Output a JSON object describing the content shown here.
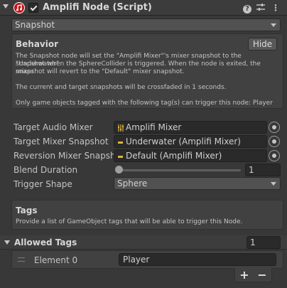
{
  "header": {
    "title": "Amplifi Node (Script)"
  },
  "node_type": {
    "selected": "Snapshot"
  },
  "behavior": {
    "title": "Behavior",
    "hide_label": "Hide",
    "desc_line1": "The Snapshot node will set the \"Amplifi Mixer\"'s mixer snapshot to the \"Underwater\"",
    "desc_line2": "snapshot when the SphereCollider is triggered. When the node is exited, the mixer",
    "desc_line3": "snapshot will revert to the \"Default\" mixer snapshot.",
    "crossfade": "The current and target snapshots will be crossfaded in 1 seconds.",
    "tags_note": "Only game objects tagged with the following tag(s) can trigger this node: Player"
  },
  "fields": {
    "target_audio_mixer": {
      "label": "Target Audio Mixer",
      "value": "Amplifi Mixer"
    },
    "target_mixer_snapshot": {
      "label": "Target Mixer Snapshot",
      "value": "Underwater (Amplifi Mixer)"
    },
    "reversion_mixer_snapshot": {
      "label": "Reversion Mixer Snapshot",
      "value": "Default (Amplifi Mixer)"
    },
    "blend_duration": {
      "label": "Blend Duration",
      "value": "1",
      "fraction": 0.0
    },
    "trigger_shape": {
      "label": "Trigger Shape",
      "value": "Sphere"
    }
  },
  "tags": {
    "title": "Tags",
    "desc": "Provide a list of GameObject tags that will be able to trigger this Node."
  },
  "allowed_tags": {
    "title": "Allowed Tags",
    "count": "1",
    "elements": [
      {
        "label": "Element 0",
        "value": "Player"
      }
    ],
    "add_label": "+",
    "remove_label": "−"
  },
  "colors": {
    "background": "#383838",
    "panel": "#414141",
    "field": "#2a2a2a",
    "script_icon": "#c0141c"
  }
}
